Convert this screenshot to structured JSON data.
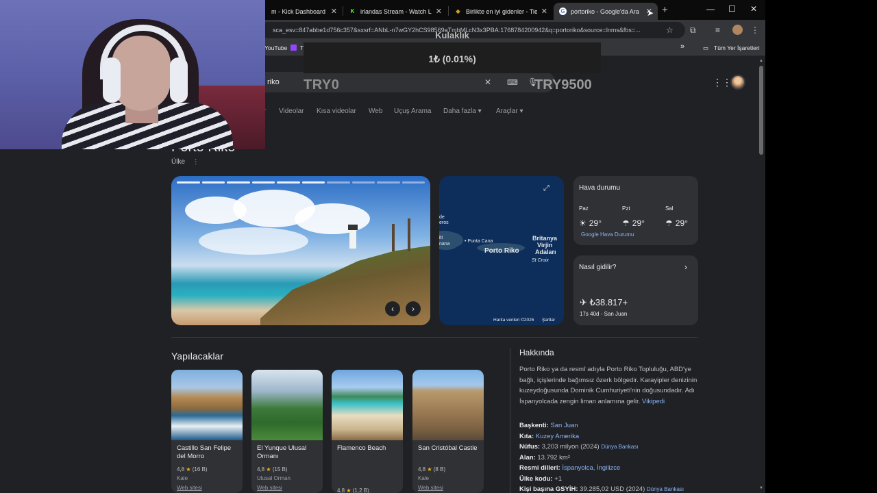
{
  "tabs": [
    {
      "title": "m - Kick Dashboard",
      "favicon": "kick-icon",
      "active": false
    },
    {
      "title": "irlandas Stream - Watch Live",
      "favicon": "kick-logo-icon",
      "active": false
    },
    {
      "title": "Birlikte en iyi gidenler - Tier",
      "favicon": "tierlist-icon",
      "active": false
    },
    {
      "title": "portoriko - Google'da Ara",
      "favicon": "google-icon",
      "active": true
    }
  ],
  "omnibox": {
    "url": "sca_esv=847abbe1d756c357&sxsrf=ANbL-n7wGY2hCS98569aTmbMLcN3x3PBA:1768784200942&q=portoriko&source=lnms&fbs=..."
  },
  "bookmarks": {
    "items": [
      "YouTube",
      "T"
    ],
    "all_bookmarks": "Tüm Yer İşaretleri"
  },
  "search": {
    "query": "riko"
  },
  "nav_tabs": [
    "r",
    "Videolar",
    "Kısa videolar",
    "Web",
    "Uçuş Arama",
    "Daha fazla",
    "Araçlar"
  ],
  "overlay": {
    "title": "Kulaklık",
    "value": "1₺ (0.01%)",
    "left_label": "TRY0",
    "right_label": "TRY9500"
  },
  "entity": {
    "title": "Porto Riko",
    "subtitle": "Ülke"
  },
  "map": {
    "labels": [
      "de",
      "eros",
      "iti",
      "nana",
      "Punta Cana",
      "Porto Riko",
      "Britanya",
      "Virjin",
      "Adaları",
      "St Croix"
    ],
    "footer_left": "Harita verileri ©2026",
    "footer_right": "Şartlar"
  },
  "weather": {
    "title": "Hava durumu",
    "days": [
      {
        "day": "Paz",
        "temp": "29°",
        "icon": "sun-icon"
      },
      {
        "day": "Pzt",
        "temp": "29°",
        "icon": "rain-icon"
      },
      {
        "day": "Sal",
        "temp": "29°",
        "icon": "rain-icon"
      }
    ],
    "link": "Google Hava Durumu"
  },
  "travel": {
    "title": "Nasıl gidilir?",
    "price": "₺38.817+",
    "detail": "17s 40d - San Juan"
  },
  "things": {
    "title": "Yapılacaklar",
    "items": [
      {
        "name": "Castillo San Felipe del Morro",
        "rating": "4,8",
        "reviews": "(16 B)",
        "kind": "Kale",
        "web": "Web sitesi"
      },
      {
        "name": "El Yunque Ulusal Ormanı",
        "rating": "4,8",
        "reviews": "(15 B)",
        "kind": "Ulusal Orman",
        "web": "Web sitesi"
      },
      {
        "name": "Flamenco Beach",
        "rating": "4,8",
        "reviews": "(1,2 B)",
        "kind": "",
        "web": ""
      },
      {
        "name": "San Cristóbal Castle",
        "rating": "4,8",
        "reviews": "(8 B)",
        "kind": "Kale",
        "web": "Web sitesi"
      }
    ]
  },
  "about": {
    "title": "Hakkında",
    "text": "Porto Riko ya da resmî adıyla Porto Riko Topluluğu, ABD'ye bağlı, içişlerinde bağımsız özerk bölgedir. Karayipler denizinin kuzeydoğusunda Dominik Cumhuriyeti'nin doğusundadır. Adı İspanyolcada zengin liman anlamına gelir.",
    "source": "Vikipedi",
    "facts": [
      {
        "label": "Başkenti:",
        "value": "San Juan",
        "value_link": true,
        "src": ""
      },
      {
        "label": "Kıta:",
        "value": "Kuzey Amerika",
        "value_link": true,
        "src": ""
      },
      {
        "label": "Nüfus:",
        "value": "3,203 milyon (2024)",
        "value_link": false,
        "src": "Dünya Bankası"
      },
      {
        "label": "Alan:",
        "value": "13.792 km²",
        "value_link": false,
        "src": ""
      },
      {
        "label": "Resmi dilleri:",
        "value": "İspanyolca, İngilizce",
        "value_link": true,
        "src": ""
      },
      {
        "label": "Ülke kodu:",
        "value": "+1",
        "value_link": false,
        "src": ""
      },
      {
        "label": "Kişi başına GSYİH:",
        "value": "39.285,02 USD (2024)",
        "value_link": false,
        "src": "Dünya Bankası"
      }
    ]
  },
  "colors": {
    "background": "#202124",
    "link": "#8ab4f8",
    "card": "#303134",
    "star": "#fbbc04"
  }
}
